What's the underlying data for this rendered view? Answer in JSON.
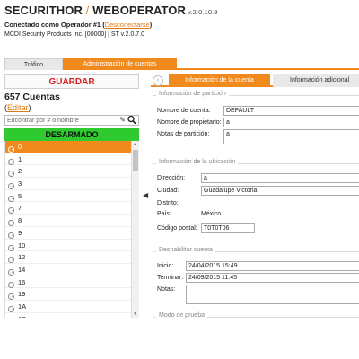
{
  "header": {
    "brand_main": "SECURITHOR",
    "brand_sep": " / ",
    "brand_product": "WEBOPERATOR",
    "version": " v.2.0.10.9",
    "connected_prefix": "Conectado como Operador #1 (",
    "disconnect_link": "Desconectarse",
    "connected_suffix": ")",
    "company_line": "MCDI Security Products Inc. [00000] | ST v.2.0.7.0"
  },
  "top_tabs": [
    {
      "label": "Tráfico",
      "active": false
    },
    {
      "label": "Administración de cuentas",
      "active": true
    }
  ],
  "left_panel": {
    "save_label": "GUARDAR",
    "accounts_count": "657 Cuentas",
    "edit_open": "(",
    "edit_link": "Editar",
    "edit_close": ")",
    "search_placeholder": "Encontrar por # o nombre",
    "status_banner": "DESARMADO",
    "accounts": [
      "0",
      "1",
      "2",
      "3",
      "5",
      "7",
      "8",
      "9",
      "10",
      "12",
      "14",
      "16",
      "19",
      "1A",
      "1B"
    ],
    "selected_index": 0
  },
  "right_panel": {
    "tabs": [
      {
        "label": "Información de la cuenta",
        "active": true
      },
      {
        "label": "Información adicional",
        "active": false
      }
    ],
    "partition": {
      "legend": "Información de partición",
      "account_name_label": "Nombre de cuenta:",
      "account_name_value": "DEFAULT",
      "owner_label": "Nombre de propietario:",
      "owner_value": "a",
      "notes_label": "Notas de partición:",
      "notes_value": "a"
    },
    "location": {
      "legend": "Información de la ubicación",
      "address_label": "Dirección:",
      "address_value": "a",
      "city_label": "Ciudad:",
      "city_value": "Guadalupe Victoria",
      "district_label": "Distrito:",
      "country_label": "País:",
      "country_value": "México",
      "postal_label": "Código postal:",
      "postal_value": "T0T0T06"
    },
    "disable": {
      "legend": "Deshabilitar cuenta",
      "start_label": "Inicio:",
      "start_value": "24/04/2015 15:49",
      "end_label": "Terminar:",
      "end_value": "24/09/2015 11:45",
      "notes_label": "Notas:"
    },
    "test_mode": {
      "legend": "Modo de prueba"
    }
  },
  "colors": {
    "accent": "#f08a1c",
    "save_text": "#d92020",
    "status_disarmed": "#2fca2f"
  }
}
